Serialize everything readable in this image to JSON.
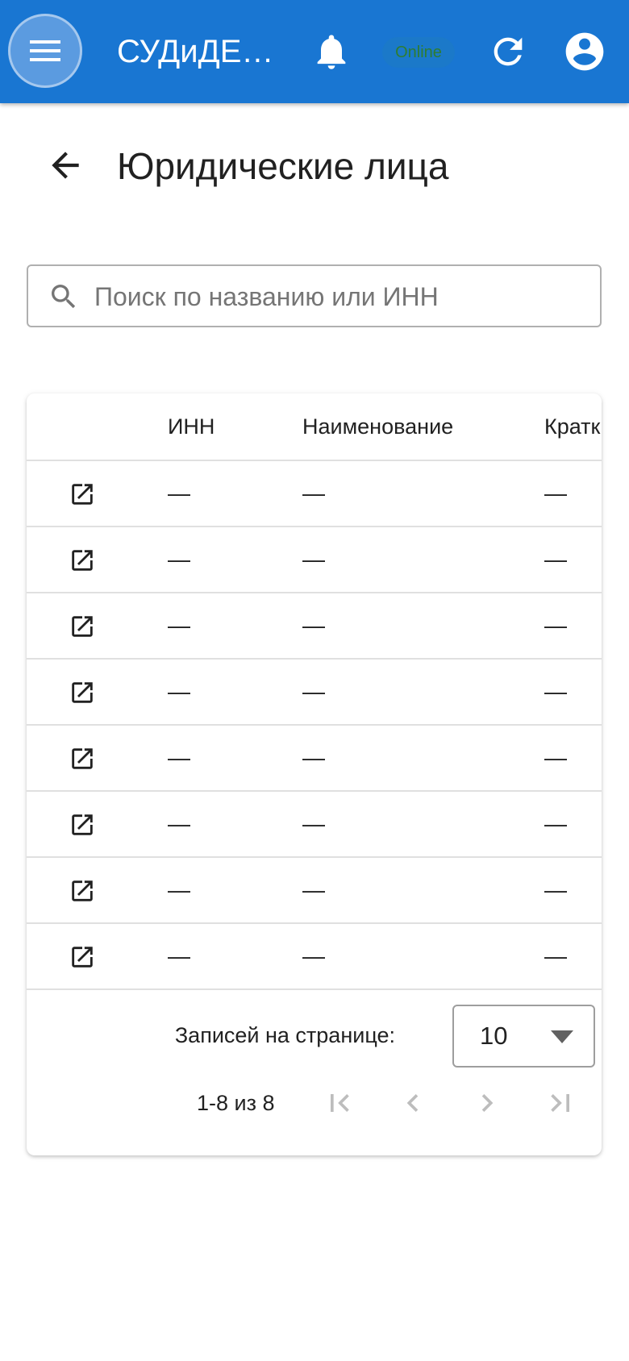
{
  "appbar": {
    "title": "СУДиДЕ…",
    "status": "Online",
    "icons": [
      "menu-icon",
      "bell-icon",
      "refresh-icon",
      "account-circle-icon"
    ]
  },
  "page": {
    "title": "Юридические лица",
    "back_icon": "arrow-left-icon"
  },
  "search": {
    "placeholder": "Поиск по названию или ИНН",
    "value": "",
    "icon": "search-icon"
  },
  "table": {
    "columns": [
      "",
      "ИНН",
      "Наименование",
      "Кратк"
    ],
    "rows": [
      {
        "inn": "—",
        "name": "—",
        "short": "—"
      },
      {
        "inn": "—",
        "name": "—",
        "short": "—"
      },
      {
        "inn": "—",
        "name": "—",
        "short": "—"
      },
      {
        "inn": "—",
        "name": "—",
        "short": "—"
      },
      {
        "inn": "—",
        "name": "—",
        "short": "—"
      },
      {
        "inn": "—",
        "name": "—",
        "short": "—"
      },
      {
        "inn": "—",
        "name": "—",
        "short": "—"
      },
      {
        "inn": "—",
        "name": "—",
        "short": "—"
      }
    ],
    "row_icon": "open-in-new-icon"
  },
  "pagination": {
    "rows_per_page_label": "Записей на странице:",
    "rows_per_page": "10",
    "range": "1-8 из 8",
    "icons": [
      "first-page-icon",
      "prev-page-icon",
      "next-page-icon",
      "last-page-icon"
    ]
  },
  "colors": {
    "appbar": "#1976d2",
    "status_text": "#2e7d32",
    "disabled": "#bdbdbd"
  }
}
